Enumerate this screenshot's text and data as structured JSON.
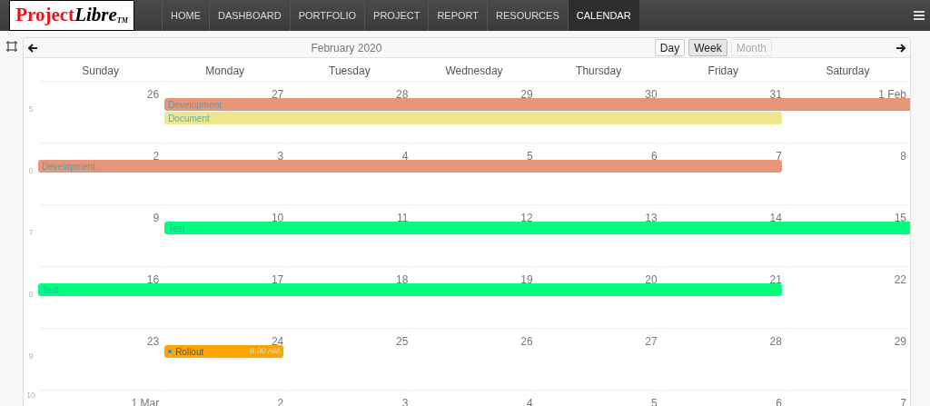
{
  "logo": {
    "brand": "Project",
    "accent": "Libre",
    "mark": "TM"
  },
  "nav": [
    {
      "label": "HOME",
      "selected": false
    },
    {
      "label": "DASHBOARD",
      "selected": false
    },
    {
      "label": "PORTFOLIO",
      "selected": false
    },
    {
      "label": "PROJECT",
      "selected": false
    },
    {
      "label": "REPORT",
      "selected": false
    },
    {
      "label": "RESOURCES",
      "selected": false
    },
    {
      "label": "CALENDAR",
      "selected": true
    }
  ],
  "calendar": {
    "title": "February 2020",
    "views": [
      {
        "label": "Day",
        "selected": false,
        "disabled": false
      },
      {
        "label": "Week",
        "selected": true,
        "disabled": false
      },
      {
        "label": "Month",
        "selected": false,
        "disabled": true
      }
    ],
    "weekdays": [
      "Sunday",
      "Monday",
      "Tuesday",
      "Wednesday",
      "Thursday",
      "Friday",
      "Saturday"
    ],
    "weeks": [
      {
        "number": "5",
        "days": [
          "26",
          "27",
          "28",
          "29",
          "30",
          "31",
          "1 Feb"
        ],
        "events": [
          {
            "kind": "bar",
            "title": "Development",
            "color": "#e8967a"
          },
          {
            "kind": "bar",
            "title": "Document",
            "color": "#f0e68c"
          }
        ]
      },
      {
        "number": "6",
        "days": [
          "2",
          "3",
          "4",
          "5",
          "6",
          "7",
          "8"
        ],
        "events": [
          {
            "kind": "bar",
            "title": "Development",
            "color": "#e8967a"
          }
        ]
      },
      {
        "number": "7",
        "days": [
          "9",
          "10",
          "11",
          "12",
          "13",
          "14",
          "15"
        ],
        "events": [
          {
            "kind": "bar",
            "title": "Test",
            "color": "#00ff7f"
          }
        ]
      },
      {
        "number": "8",
        "days": [
          "16",
          "17",
          "18",
          "19",
          "20",
          "21",
          "22"
        ],
        "events": [
          {
            "kind": "bar",
            "title": "Test",
            "color": "#00ff7f"
          }
        ]
      },
      {
        "number": "9",
        "days": [
          "23",
          "24",
          "25",
          "26",
          "27",
          "28",
          "29"
        ],
        "events": [
          {
            "kind": "timed",
            "title": "Rollout",
            "time": "8:00 AM",
            "color": "#ffa500"
          }
        ]
      },
      {
        "number": "10",
        "days": [
          "1 Mar",
          "2",
          "3",
          "4",
          "5",
          "6",
          "7"
        ]
      }
    ]
  }
}
